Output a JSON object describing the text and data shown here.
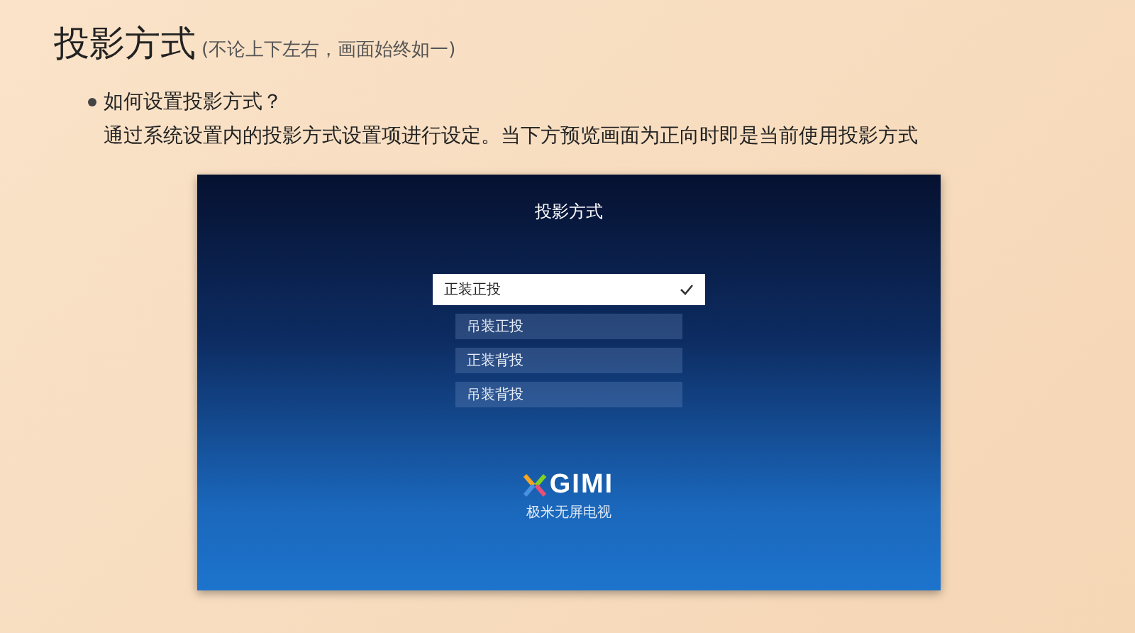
{
  "slide": {
    "title": "投影方式",
    "subtitle": "(不论上下左右，画面始终如一)",
    "bullet": "如何设置投影方式？",
    "description": "通过系统设置内的投影方式设置项进行设定。当下方预览画面为正向时即是当前使用投影方式"
  },
  "screen": {
    "title": "投影方式",
    "options": [
      {
        "label": "正装正投",
        "selected": true
      },
      {
        "label": "吊装正投",
        "selected": false
      },
      {
        "label": "正装背投",
        "selected": false
      },
      {
        "label": "吊装背投",
        "selected": false
      }
    ],
    "logo": "GIMI",
    "tagline": "极米无屏电视"
  }
}
